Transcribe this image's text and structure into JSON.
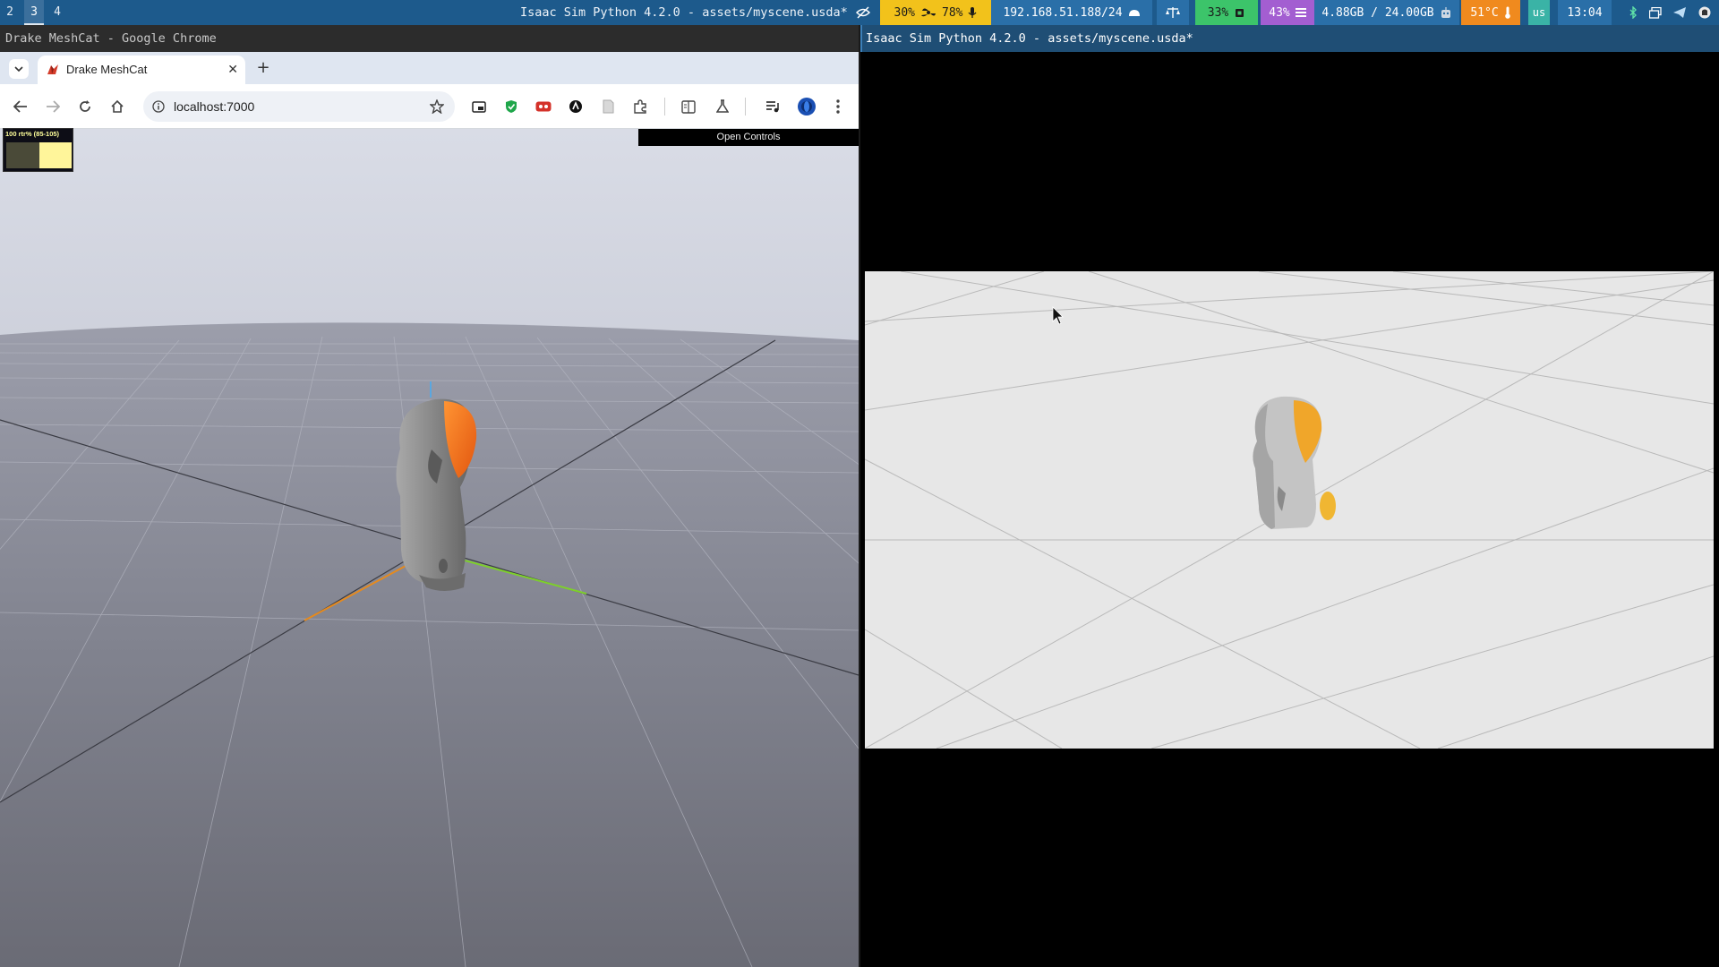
{
  "topbar": {
    "workspaces": [
      "2",
      "3",
      "4"
    ],
    "active_workspace": "3",
    "window_title": "Isaac Sim Python 4.2.0 - assets/myscene.usda*",
    "cpu": "30%",
    "volume": "78%",
    "network": "192.168.51.188/24",
    "gpu": "33%",
    "mem_percent": "43%",
    "memory": "4.88GB / 24.00GB",
    "temperature": "51°C",
    "keyboard_layout": "us",
    "clock": "13:04",
    "colors": {
      "bar_bg": "#1d5a8c",
      "cpu_vol": "#f2c21b",
      "network": "#2a6fa8",
      "gpu": "#3cc46a",
      "mem": "#a35ed1",
      "temp": "#f08a1e",
      "kbd": "#3ab3a6"
    }
  },
  "chrome_window": {
    "title": "Drake MeshCat - Google Chrome",
    "tab_title": "Drake MeshCat",
    "url": "localhost:7000",
    "icons": [
      "tab-search-icon",
      "close-icon",
      "new-tab-icon",
      "back-icon",
      "forward-icon",
      "reload-icon",
      "home-icon",
      "site-info-icon",
      "bookmark-star-icon",
      "picture-in-picture-icon",
      "shield-extension-icon",
      "record-extension-icon",
      "api-extension-icon",
      "doc-extension-icon",
      "extensions-icon",
      "reading-list-icon",
      "labs-icon",
      "media-control-icon",
      "profile-avatar-icon",
      "menu-icon"
    ]
  },
  "meshcat": {
    "stats_label": "100 rtr% (85-105)",
    "open_controls": "Open Controls"
  },
  "isaac_window": {
    "title": "Isaac Sim Python 4.2.0 - assets/myscene.usda*"
  }
}
